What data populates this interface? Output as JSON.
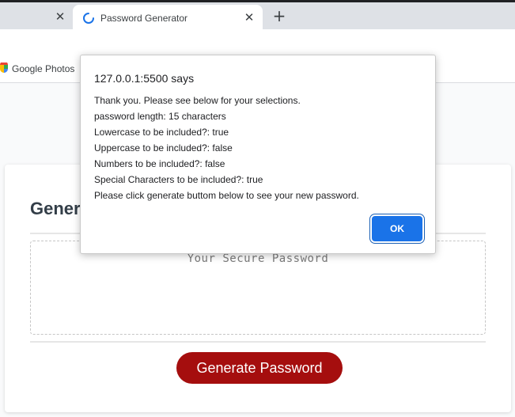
{
  "browser": {
    "inactive_tab_close": "✕",
    "active_tab": {
      "title": "Password Generator",
      "close": "✕",
      "icon": "loading-spinner-icon"
    },
    "new_tab": "+",
    "bookmarks": [
      {
        "label": "Google Photos",
        "icon": "google-photos-icon"
      }
    ]
  },
  "page": {
    "card_title": "Generate a Password",
    "password_placeholder": "Your Secure Password",
    "generate_button": "Generate Password",
    "button_color": "#a50e0e"
  },
  "dialog": {
    "origin": "127.0.0.1:5500 says",
    "lines": [
      "Thank you. Please see below for your selections.",
      "password length: 15 characters",
      "Lowercase to be included?: true",
      "Uppercase to be included?: false",
      "Numbers to be included?: false",
      "Special Characters to be included?: true",
      "Please click generate buttom below to see your new password."
    ],
    "ok_button": "OK",
    "accent_color": "#1a73e8"
  }
}
